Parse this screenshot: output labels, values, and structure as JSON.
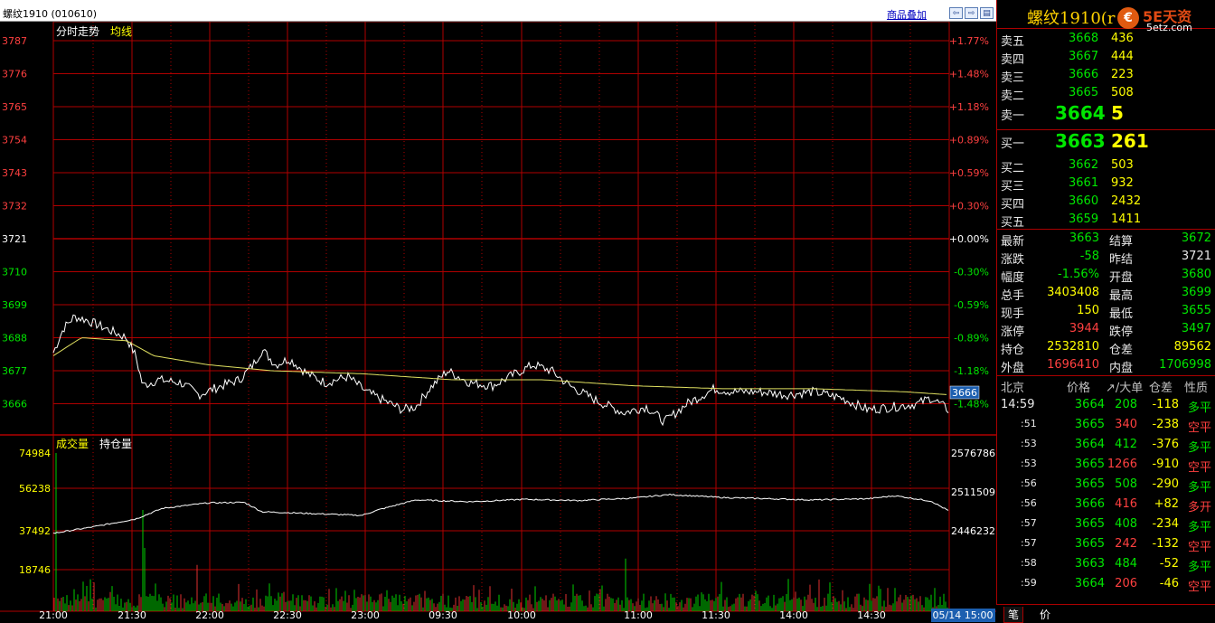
{
  "window_title": "螺纹1910 (010610)",
  "overlay_link": "商品叠加",
  "nav_buttons": [
    "⇦",
    "⇨",
    "▤"
  ],
  "price_panel": {
    "title_label": "分时走势",
    "avg_label": "均线",
    "left_ticks": [
      "3787",
      "3776",
      "3765",
      "3754",
      "3743",
      "3732",
      "3721",
      "3710",
      "3699",
      "3688",
      "3677",
      "3666"
    ],
    "right_ticks": [
      "+1.77%",
      "+1.48%",
      "+1.18%",
      "+0.89%",
      "+0.59%",
      "+0.30%",
      "+0.00%",
      "-0.30%",
      "-0.59%",
      "-0.89%",
      "-1.18%",
      "-1.48%"
    ],
    "current_price_tag": "3666",
    "colors": {
      "up": "#ff4040",
      "flat": "#ffffff",
      "down": "#00e600",
      "grid": "#b00000",
      "price": "#ffffff",
      "avg": "#e0e060"
    }
  },
  "volume_panel": {
    "vol_label": "成交量",
    "oi_label": "持仓量",
    "left_ticks": [
      "74984",
      "56238",
      "37492",
      "18746"
    ],
    "right_ticks": [
      "2576786",
      "2511509",
      "2446232"
    ]
  },
  "time_axis": [
    "21:00",
    "21:30",
    "22:00",
    "22:30",
    "23:00",
    "09:30",
    "10:00",
    "11:00",
    "11:30",
    "14:00",
    "14:30"
  ],
  "date_tag": "05/14 15:00",
  "quote": {
    "title": "螺纹1910(r",
    "logo_text": "5E天资",
    "logo_url": "5etz.com",
    "sells": [
      {
        "label": "卖五",
        "price": "3668",
        "vol": "436"
      },
      {
        "label": "卖四",
        "price": "3667",
        "vol": "444"
      },
      {
        "label": "卖三",
        "price": "3666",
        "vol": "223"
      },
      {
        "label": "卖二",
        "price": "3665",
        "vol": "508"
      },
      {
        "label": "卖一",
        "price": "3664",
        "vol": "5"
      }
    ],
    "buys": [
      {
        "label": "买一",
        "price": "3663",
        "vol": "261"
      },
      {
        "label": "买二",
        "price": "3662",
        "vol": "503"
      },
      {
        "label": "买三",
        "price": "3661",
        "vol": "932"
      },
      {
        "label": "买四",
        "price": "3660",
        "vol": "2432"
      },
      {
        "label": "买五",
        "price": "3659",
        "vol": "1411"
      }
    ],
    "stats": [
      {
        "l1": "最新",
        "v1": "3663",
        "c1": "g",
        "l2": "结算",
        "v2": "3672",
        "c2": "g"
      },
      {
        "l1": "涨跌",
        "v1": "-58",
        "c1": "g",
        "l2": "昨结",
        "v2": "3721",
        "c2": "w"
      },
      {
        "l1": "幅度",
        "v1": "-1.56%",
        "c1": "g",
        "l2": "开盘",
        "v2": "3680",
        "c2": "g"
      },
      {
        "l1": "总手",
        "v1": "3403408",
        "c1": "y",
        "l2": "最高",
        "v2": "3699",
        "c2": "g"
      },
      {
        "l1": "现手",
        "v1": "150",
        "c1": "y",
        "l2": "最低",
        "v2": "3655",
        "c2": "g"
      },
      {
        "l1": "涨停",
        "v1": "3944",
        "c1": "r",
        "l2": "跌停",
        "v2": "3497",
        "c2": "g"
      },
      {
        "l1": "持仓",
        "v1": "2532810",
        "c1": "y",
        "l2": "仓差",
        "v2": "89562",
        "c2": "y"
      },
      {
        "l1": "外盘",
        "v1": "1696410",
        "c1": "r",
        "l2": "内盘",
        "v2": "1706998",
        "c2": "g"
      }
    ],
    "ticks_header": [
      "北京",
      "价格",
      "↗/大单",
      "仓差",
      "性质"
    ],
    "ticks": [
      {
        "time": "14:59",
        "price": "3664",
        "vol": "208",
        "vc": "g",
        "diff": "-118",
        "nature": "多平",
        "nc": "g"
      },
      {
        "time": ":51",
        "price": "3665",
        "vol": "340",
        "vc": "r",
        "diff": "-238",
        "nature": "空平",
        "nc": "r"
      },
      {
        "time": ":53",
        "price": "3664",
        "vol": "412",
        "vc": "g",
        "diff": "-376",
        "nature": "多平",
        "nc": "g"
      },
      {
        "time": ":53",
        "price": "3665",
        "vol": "1266",
        "vc": "r",
        "diff": "-910",
        "nature": "空平",
        "nc": "r"
      },
      {
        "time": ":56",
        "price": "3665",
        "vol": "508",
        "vc": "g",
        "diff": "-290",
        "nature": "多平",
        "nc": "g"
      },
      {
        "time": ":56",
        "price": "3666",
        "vol": "416",
        "vc": "r",
        "diff": "+82",
        "nature": "多开",
        "nc": "r"
      },
      {
        "time": ":57",
        "price": "3665",
        "vol": "408",
        "vc": "g",
        "diff": "-234",
        "nature": "多平",
        "nc": "g"
      },
      {
        "time": ":57",
        "price": "3665",
        "vol": "242",
        "vc": "r",
        "diff": "-132",
        "nature": "空平",
        "nc": "r"
      },
      {
        "time": ":58",
        "price": "3663",
        "vol": "484",
        "vc": "g",
        "diff": "-52",
        "nature": "多平",
        "nc": "g"
      },
      {
        "time": ":59",
        "price": "3664",
        "vol": "206",
        "vc": "r",
        "diff": "-46",
        "nature": "空平",
        "nc": "r"
      }
    ],
    "tabs": [
      "笔",
      "价"
    ]
  }
}
